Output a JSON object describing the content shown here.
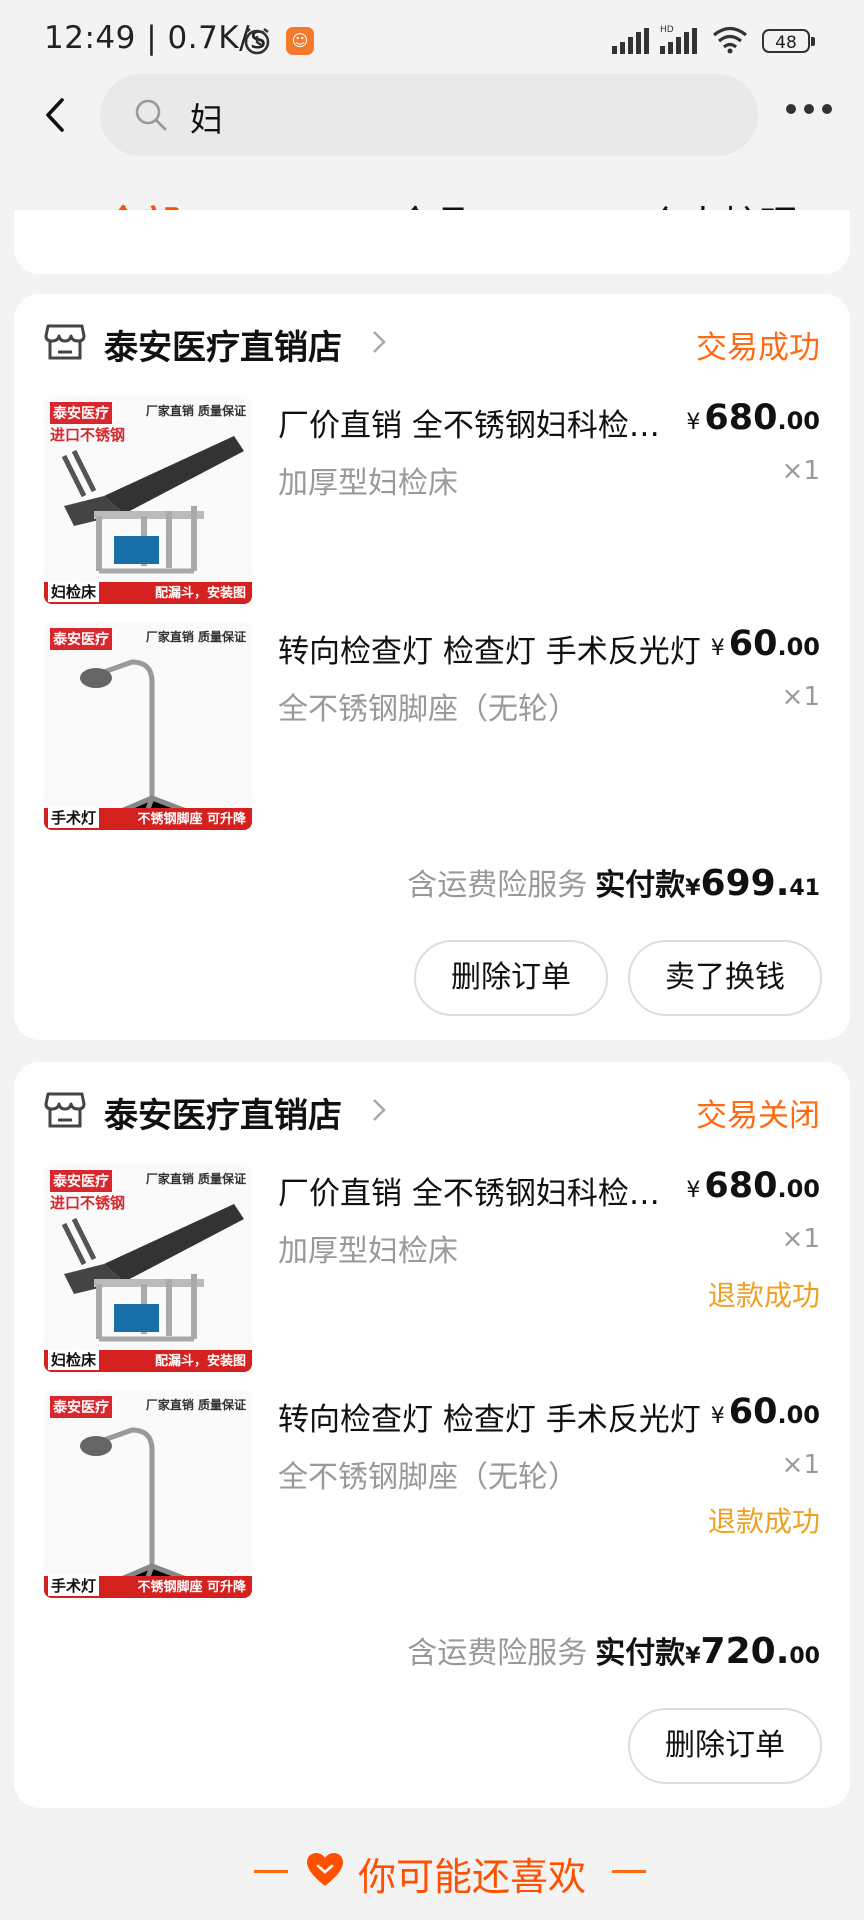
{
  "status_bar": {
    "time": "12:49",
    "speed": "0.7K/s",
    "battery": "48"
  },
  "search": {
    "query": "妇"
  },
  "tabs": [
    {
      "label": "全部",
      "active": true
    },
    {
      "label": "食品",
      "active": false
    },
    {
      "label": "个人护理",
      "active": false
    }
  ],
  "orders": [
    {
      "shop": "泰安医疗直销店",
      "status": "交易成功",
      "items": [
        {
          "title": "厂价直销 全不锈钢妇科检查床",
          "sku": "加厚型妇检床",
          "price_int": "680",
          "price_dec": ".00",
          "currency": "¥",
          "qty": "×1",
          "thumb": {
            "tag": "泰安医疗",
            "sub": "进口不锈钢",
            "corner": "厂家直销 质量保证",
            "name": "妇检床",
            "banner": "配漏斗，安装图"
          }
        },
        {
          "title": "转向检查灯 检查灯 手术反光灯",
          "sku": "全不锈钢脚座（无轮）",
          "price_int": "60",
          "price_dec": ".00",
          "currency": "¥",
          "qty": "×1",
          "thumb": {
            "tag": "泰安医疗",
            "sub": "",
            "corner": "厂家直销 质量保证",
            "name": "手术灯",
            "banner": "不锈钢脚座 可升降"
          }
        }
      ],
      "insurance": "含运费险服务",
      "paid_label": "实付款",
      "paid_cur": "¥",
      "paid_int": "699.",
      "paid_dec": "41",
      "buttons": [
        "删除订单",
        "卖了换钱"
      ]
    },
    {
      "shop": "泰安医疗直销店",
      "status": "交易关闭",
      "items": [
        {
          "title": "厂价直销 全不锈钢妇科检查床",
          "sku": "加厚型妇检床",
          "price_int": "680",
          "price_dec": ".00",
          "currency": "¥",
          "qty": "×1",
          "refund": "退款成功",
          "thumb": {
            "tag": "泰安医疗",
            "sub": "进口不锈钢",
            "corner": "厂家直销 质量保证",
            "name": "妇检床",
            "banner": "配漏斗，安装图"
          }
        },
        {
          "title": "转向检查灯 检查灯 手术反光灯",
          "sku": "全不锈钢脚座（无轮）",
          "price_int": "60",
          "price_dec": ".00",
          "currency": "¥",
          "qty": "×1",
          "refund": "退款成功",
          "thumb": {
            "tag": "泰安医疗",
            "sub": "",
            "corner": "厂家直销 质量保证",
            "name": "手术灯",
            "banner": "不锈钢脚座 可升降"
          }
        }
      ],
      "insurance": "含运费险服务",
      "paid_label": "实付款",
      "paid_cur": "¥",
      "paid_int": "720.",
      "paid_dec": "00",
      "buttons": [
        "删除订单"
      ]
    }
  ],
  "recommend": {
    "title": "你可能还喜欢"
  },
  "colors": {
    "accent": "#ff5000",
    "status": "#ff6a14",
    "refund": "#f0a020",
    "muted": "#999999"
  }
}
